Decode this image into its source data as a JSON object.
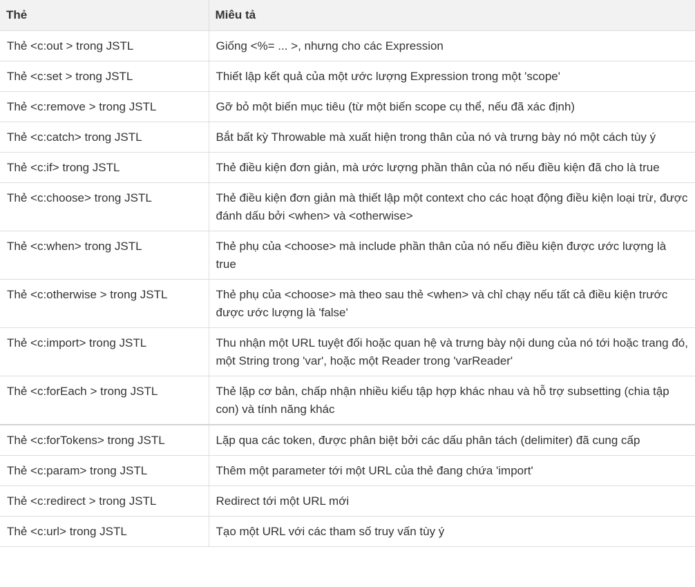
{
  "table": {
    "headers": {
      "tag": "Thẻ",
      "description": "Miêu tả"
    },
    "rows": [
      {
        "tag": "Thẻ <c:out > trong JSTL",
        "description": "Giống <%= ... >, nhưng cho các Expression"
      },
      {
        "tag": "Thẻ <c:set > trong JSTL",
        "description": "Thiết lập kết quả của một ước lượng Expression trong một 'scope'"
      },
      {
        "tag": "Thẻ <c:remove > trong JSTL",
        "description": "Gỡ bỏ một biến mục tiêu (từ một biến scope cụ thể, nếu đã xác định)"
      },
      {
        "tag": "Thẻ <c:catch> trong JSTL",
        "description": "Bắt bất kỳ Throwable mà xuất hiện trong thân của nó và trưng bày nó một cách tùy ý"
      },
      {
        "tag": "Thẻ <c:if> trong JSTL",
        "description": "Thẻ điều kiện đơn giản, mà ước lượng phần thân của nó nếu điều kiện đã cho là true"
      },
      {
        "tag": "Thẻ <c:choose> trong JSTL",
        "description": "Thẻ điều kiện đơn giản mà thiết lập một context cho các hoạt động điều kiện loại trừ, được đánh dấu bởi <when> và <otherwise>"
      },
      {
        "tag": "Thẻ <c:when> trong JSTL",
        "description": "Thẻ phụ của <choose> mà include phần thân của nó nếu điều kiện được ước lượng là true"
      },
      {
        "tag": "Thẻ <c:otherwise > trong JSTL",
        "description": "Thẻ phụ của <choose> mà theo sau thẻ <when> và chỉ chạy nếu tất cả điều kiện trước được ước lượng là 'false'"
      },
      {
        "tag": "Thẻ <c:import> trong JSTL",
        "description": "Thu nhận một URL tuyệt đối hoặc quan hệ và trưng bày nội dung của nó tới hoặc trang đó, một String trong 'var', hoặc một Reader trong 'varReader'"
      },
      {
        "tag": "Thẻ <c:forEach > trong JSTL",
        "description": "Thẻ lặp cơ bản, chấp nhận nhiều kiểu tập hợp khác nhau và hỗ trợ subsetting (chia tập con) và tính năng khác"
      },
      {
        "tag": "Thẻ <c:forTokens> trong JSTL",
        "description": "Lặp qua các token, được phân biệt bởi các dấu phân tách (delimiter) đã cung cấp"
      },
      {
        "tag": "Thẻ <c:param> trong JSTL",
        "description": "Thêm một parameter tới một URL của thẻ đang chứa 'import'"
      },
      {
        "tag": "Thẻ <c:redirect > trong JSTL",
        "description": "Redirect tới một URL mới"
      },
      {
        "tag": "Thẻ <c:url> trong JSTL",
        "description": "Tạo một URL với các tham số truy vấn tùy ý"
      }
    ]
  }
}
